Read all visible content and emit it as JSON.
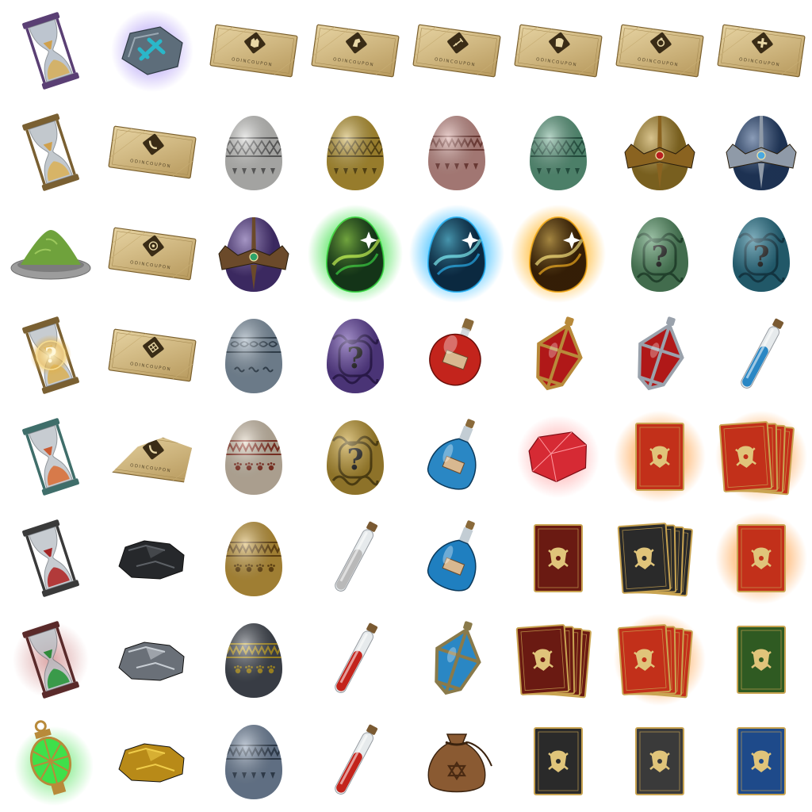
{
  "colors": {
    "gold": "#c9a451",
    "gold_dark": "#7a5a1e",
    "parchment": "#d8c08c",
    "red": "#c3241c",
    "blue": "#2a87c4",
    "green": "#3f8a4c",
    "purple": "#5b3f93"
  },
  "coupon": {
    "label": "ODINCOUPON"
  },
  "egg_badge": {
    "mystery_glyph": "?"
  },
  "hourglass_badge": {
    "mystery_glyph": "?"
  },
  "rows": [
    [
      {
        "icon": "purple-hourglass-icon",
        "kind": "hourglass",
        "frame": "#5a3f74",
        "top": "#a8b2bf",
        "bottom": "#d3b26a",
        "sand": "#cfa04c"
      },
      {
        "icon": "rune-stone-glow-icon",
        "kind": "runestone",
        "color": "#2ab7c9",
        "glow": "#8a6cf0"
      },
      {
        "icon": "odin-coupon-wolf-icon",
        "kind": "coupon",
        "emblem": "wolf"
      },
      {
        "icon": "odin-coupon-horse-icon",
        "kind": "coupon",
        "emblem": "horse"
      },
      {
        "icon": "odin-coupon-sword-icon",
        "kind": "coupon",
        "emblem": "sword"
      },
      {
        "icon": "odin-coupon-armor-icon",
        "kind": "coupon",
        "emblem": "armor"
      },
      {
        "icon": "odin-coupon-ring-icon",
        "kind": "coupon",
        "emblem": "ring"
      },
      {
        "icon": "odin-coupon-cross-icon",
        "kind": "coupon",
        "emblem": "cross"
      }
    ],
    [
      {
        "icon": "bronze-hourglass-icon",
        "kind": "hourglass",
        "frame": "#7a6032",
        "top": "#aeb6bd",
        "bottom": "#d7b467",
        "sand": "#cfa04c"
      },
      {
        "icon": "odin-coupon-horn-icon",
        "kind": "coupon",
        "emblem": "horn"
      },
      {
        "icon": "white-egg-icon",
        "kind": "egg",
        "base": "#d9d9d6",
        "band": "#6f6f6f",
        "pattern": "knot"
      },
      {
        "icon": "yellow-egg-icon",
        "kind": "egg",
        "base": "#c9a63a",
        "band": "#6a5418",
        "pattern": "knot"
      },
      {
        "icon": "pink-egg-icon",
        "kind": "egg",
        "base": "#d79e98",
        "band": "#8a4a44",
        "pattern": "zigzag"
      },
      {
        "icon": "teal-egg-icon",
        "kind": "egg",
        "base": "#66a98b",
        "band": "#2f6450",
        "pattern": "knot"
      },
      {
        "icon": "gold-crowned-egg-icon",
        "kind": "crowned_egg",
        "base": "#b8922f",
        "crown": "#8a6320",
        "gem": "#b82020"
      },
      {
        "icon": "blue-crowned-egg-icon",
        "kind": "crowned_egg",
        "base": "#2c4c7e",
        "crown": "#8f9aa8",
        "gem": "#4aa8e0"
      }
    ],
    [
      {
        "icon": "green-powder-bowl-icon",
        "kind": "powder",
        "powder": "#6fa23c",
        "bowl": "#9c9c9c"
      },
      {
        "icon": "odin-coupon-shield-icon",
        "kind": "coupon",
        "emblem": "shield"
      },
      {
        "icon": "purple-crowned-egg-icon",
        "kind": "crowned_egg",
        "base": "#5b3f93",
        "crown": "#6b4a2a",
        "gem": "#2ea36a"
      },
      {
        "icon": "green-glow-egg-icon",
        "kind": "glow_egg",
        "base": "#1c4a22",
        "glow": "#3fe04a",
        "swirl": "#c6ff5a"
      },
      {
        "icon": "blue-glow-egg-icon",
        "kind": "glow_egg",
        "base": "#103a5c",
        "glow": "#2ab8ff",
        "swirl": "#7df0ff"
      },
      {
        "icon": "orange-glow-egg-icon",
        "kind": "glow_egg",
        "base": "#4a2a08",
        "glow": "#ffb21e",
        "swirl": "#ffe27a"
      },
      {
        "icon": "green-mystery-egg-icon",
        "kind": "mystery_egg",
        "base": "#5e9b6e",
        "band": "#2f5c3e"
      },
      {
        "icon": "teal-mystery-egg-icon",
        "kind": "mystery_egg",
        "base": "#2f7d95",
        "band": "#1a4a5c"
      }
    ],
    [
      {
        "icon": "mystery-hourglass-icon",
        "kind": "mystery_hourglass",
        "frame": "#7a6032",
        "glow": "#e0b04a"
      },
      {
        "icon": "odin-coupon-knot-icon",
        "kind": "coupon",
        "emblem": "knot"
      },
      {
        "icon": "blue-grey-egg-icon",
        "kind": "egg",
        "base": "#8fa3b5",
        "band": "#3e5060",
        "pattern": "wave"
      },
      {
        "icon": "purple-mystery-egg-icon",
        "kind": "mystery_egg",
        "base": "#6a4aa8",
        "band": "#3a2466"
      },
      {
        "icon": "red-potion-flask-icon",
        "kind": "round_potion",
        "liquid": "#c3241c",
        "label": "#d8b890"
      },
      {
        "icon": "red-crystal-potion-icon",
        "kind": "cage_potion",
        "liquid": "#b01818",
        "cage": "#b88a3a"
      },
      {
        "icon": "red-crystal-potion-silver-icon",
        "kind": "cage_potion",
        "liquid": "#b01818",
        "cage": "#9aa2ac"
      },
      {
        "icon": "blue-vial-icon",
        "kind": "vial",
        "liquid": "#2a87c4"
      }
    ],
    [
      {
        "icon": "teal-hourglass-icon",
        "kind": "hourglass",
        "frame": "#3f6e6a",
        "top": "#b5bcc2",
        "bottom": "#d77a4a",
        "sand": "#c95c34"
      },
      {
        "icon": "torn-coupon-icon",
        "kind": "torn_coupon",
        "emblem": "horn"
      },
      {
        "icon": "cream-egg-icon",
        "kind": "egg",
        "base": "#e2d3bd",
        "band": "#9a3a2a",
        "pattern": "zigzag_paw"
      },
      {
        "icon": "gold-mystery-egg-icon",
        "kind": "mystery_egg",
        "base": "#c9a33a",
        "band": "#6a5418"
      },
      {
        "icon": "blue-potion-bottle-icon",
        "kind": "bottle_potion",
        "liquid": "#2a87c4"
      },
      {
        "icon": "red-gem-icon",
        "kind": "gem",
        "color": "#d62a34",
        "glow": "#ff6a6a"
      },
      {
        "icon": "red-card-icon",
        "kind": "card",
        "color": "#c2301a",
        "count": 1,
        "glow": true
      },
      {
        "icon": "red-card-stack-icon",
        "kind": "card",
        "color": "#c2301a",
        "count": 4,
        "glow": true
      }
    ],
    [
      {
        "icon": "black-hourglass-icon",
        "kind": "hourglass",
        "frame": "#3a3a3a",
        "top": "#b5bcc2",
        "bottom": "#b23a3a",
        "sand": "#a32424"
      },
      {
        "icon": "coal-ore-icon",
        "kind": "ore",
        "color": "#26282b",
        "highlight": "#5d6166"
      },
      {
        "icon": "golden-paw-egg-icon",
        "kind": "egg",
        "base": "#d4a844",
        "band": "#7a5418",
        "pattern": "zigzag_paw"
      },
      {
        "icon": "empty-vial-icon",
        "kind": "vial",
        "liquid": "#b9b9b9"
      },
      {
        "icon": "blue-potion-large-icon",
        "kind": "bottle_potion",
        "liquid": "#1f7fc0"
      },
      {
        "icon": "dark-red-card-icon",
        "kind": "card",
        "color": "#6a1a12",
        "count": 1,
        "glow": false
      },
      {
        "icon": "black-card-stack-icon",
        "kind": "card",
        "color": "#2a2a2a",
        "count": 4,
        "glow": false
      },
      {
        "icon": "red-rune-card-icon",
        "kind": "card",
        "color": "#c2301a",
        "count": 1,
        "glow": true
      }
    ],
    [
      {
        "icon": "cursed-hourglass-icon",
        "kind": "hourglass",
        "frame": "#5a2a2a",
        "top": "#b5bcc2",
        "bottom": "#3a9a4a",
        "sand": "#2f8a3a",
        "aura": "#c46a6a"
      },
      {
        "icon": "iron-ore-icon",
        "kind": "ore",
        "color": "#6a7078",
        "highlight": "#c8ced4"
      },
      {
        "icon": "slate-paw-egg-icon",
        "kind": "egg",
        "base": "#4a505a",
        "band": "#c9a82a",
        "pattern": "zigzag_paw"
      },
      {
        "icon": "red-vial-icon",
        "kind": "vial",
        "liquid": "#c3241c"
      },
      {
        "icon": "blue-caged-potion-icon",
        "kind": "cage_potion",
        "liquid": "#2a87c4",
        "cage": "#8a7a4a"
      },
      {
        "icon": "dark-red-card-stack-icon",
        "kind": "card",
        "color": "#6a1a12",
        "count": 4,
        "glow": false
      },
      {
        "icon": "red-rune-card-stack-icon",
        "kind": "card",
        "color": "#c2301a",
        "count": 4,
        "glow": true
      },
      {
        "icon": "green-card-icon",
        "kind": "card",
        "color": "#2f5a22",
        "count": 1,
        "glow": false
      }
    ],
    [
      {
        "icon": "green-lantern-icon",
        "kind": "lantern",
        "light": "#3fe04a",
        "frame": "#b88a3a"
      },
      {
        "icon": "gold-ore-icon",
        "kind": "ore",
        "color": "#b88a18",
        "highlight": "#f0cd4a"
      },
      {
        "icon": "blue-grey-egg-2-icon",
        "kind": "egg",
        "base": "#7f93ad",
        "band": "#3a4a5e",
        "pattern": "zigzag"
      },
      {
        "icon": "red-tube-potion-icon",
        "kind": "vial",
        "liquid": "#c3241c"
      },
      {
        "icon": "leather-pouch-icon",
        "kind": "pouch",
        "color": "#8a5a32"
      },
      {
        "icon": "black-card-icon",
        "kind": "card",
        "color": "#2a2a2a",
        "count": 1,
        "glow": false
      },
      {
        "icon": "black-silver-card-icon",
        "kind": "card",
        "color": "#3a3a3a",
        "count": 1,
        "glow": false
      },
      {
        "icon": "blue-card-icon",
        "kind": "card",
        "color": "#1e4a8a",
        "count": 1,
        "glow": false
      }
    ]
  ]
}
